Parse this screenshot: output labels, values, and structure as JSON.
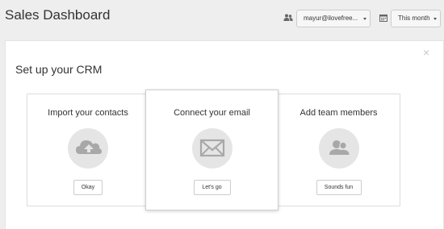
{
  "header": {
    "title": "Sales Dashboard",
    "user_select": {
      "value": "mayur@ilovefree...",
      "icon": "users-icon"
    },
    "period_select": {
      "value": "This month",
      "icon": "calendar-icon"
    }
  },
  "crm_panel": {
    "title": "Set up your CRM",
    "close_glyph": "×",
    "cards": [
      {
        "title": "Import your contacts",
        "button": "Okay",
        "icon": "cloud-upload-icon"
      },
      {
        "title": "Connect your email",
        "button": "Let's go",
        "icon": "envelope-icon"
      },
      {
        "title": "Add team members",
        "button": "Sounds fun",
        "icon": "users-icon"
      }
    ]
  },
  "colors": {
    "background": "#eeeeee",
    "panel": "#ffffff",
    "icon_circle": "#e5e5e5",
    "icon_glyph": "#a8a8a8",
    "text": "#333333"
  }
}
